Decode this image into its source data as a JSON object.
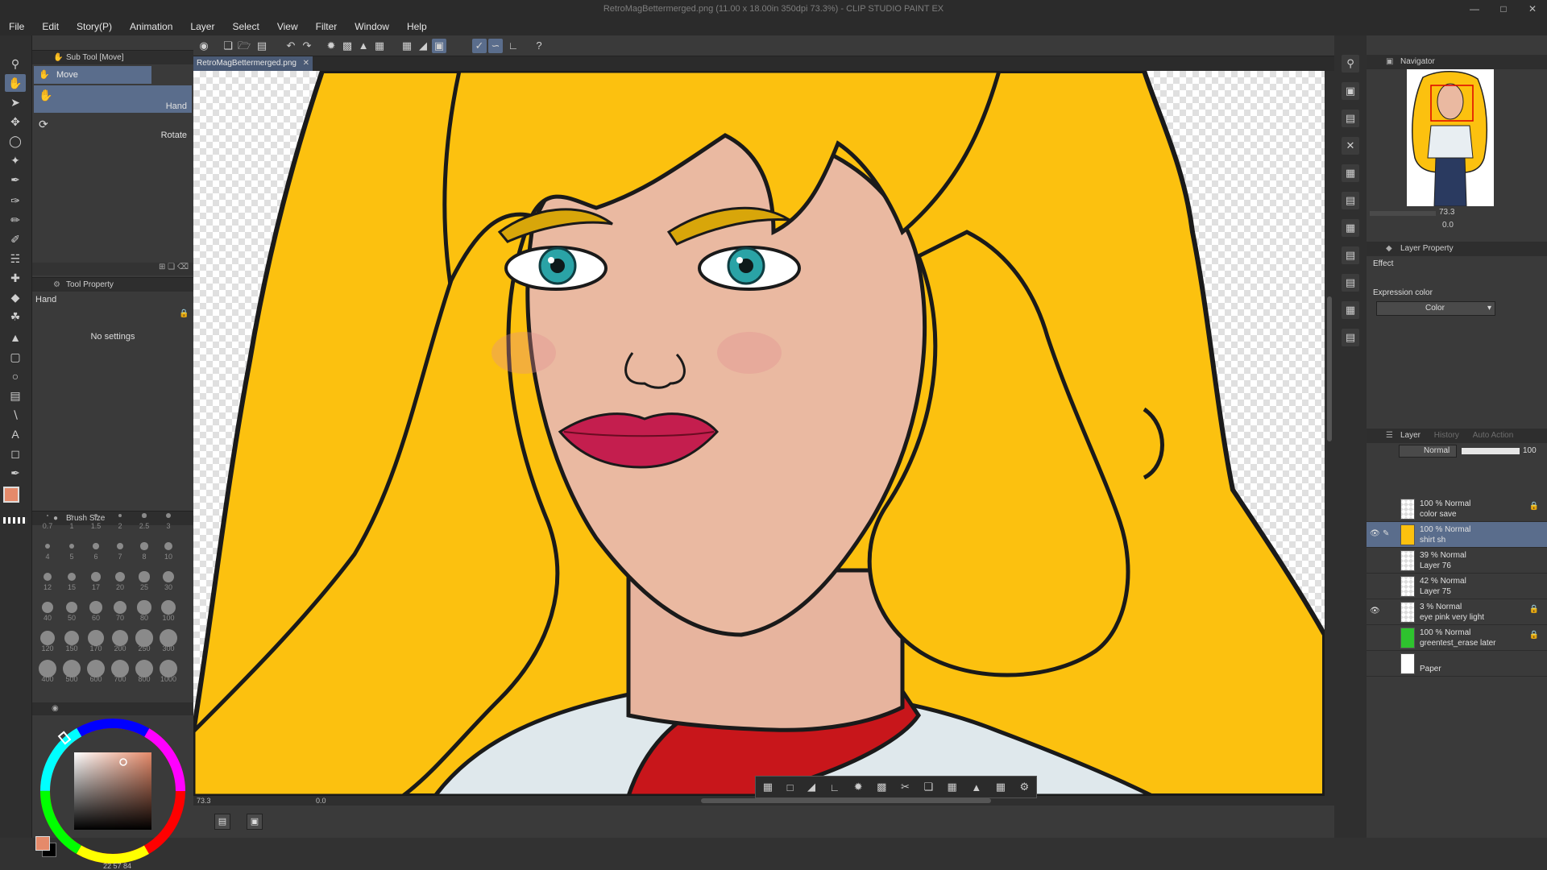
{
  "window": {
    "title": "RetroMagBettermerged.png (11.00 x 18.00in 350dpi 73.3%)  - CLIP STUDIO PAINT EX"
  },
  "menu": [
    "File",
    "Edit",
    "Story(P)",
    "Animation",
    "Layer",
    "Select",
    "View",
    "Filter",
    "Window",
    "Help"
  ],
  "subtool": {
    "header": "Sub Tool [Move]",
    "group": "Move",
    "items": [
      {
        "label": "Hand",
        "selected": true
      },
      {
        "label": "Rotate",
        "selected": false
      }
    ]
  },
  "tool_property": {
    "header": "Tool Property",
    "tool_name": "Hand",
    "message": "No settings"
  },
  "brush_size": {
    "header": "Brush Size",
    "sizes": [
      "0.7",
      "1",
      "1.5",
      "2",
      "2.5",
      "3",
      "4",
      "5",
      "6",
      "7",
      "8",
      "10",
      "12",
      "15",
      "17",
      "20",
      "25",
      "30",
      "40",
      "50",
      "60",
      "70",
      "80",
      "100",
      "120",
      "150",
      "170",
      "200",
      "250",
      "300",
      "400",
      "500",
      "600",
      "700",
      "800",
      "1000"
    ]
  },
  "color": {
    "main": "#e58a6a",
    "sub": "#000000",
    "readout": "22  57  84"
  },
  "canvas": {
    "tab": "RetroMagBettermerged.png",
    "zoom": "73.3",
    "rotation": "0.0"
  },
  "navigator": {
    "header": "Navigator",
    "zoom": "73.3",
    "angle": "0.0"
  },
  "layer_property": {
    "header": "Layer Property",
    "effect_label": "Effect",
    "expression_label": "Expression color",
    "expression_value": "Color"
  },
  "layer_panel": {
    "tabs": [
      "Layer",
      "History",
      "Auto Action"
    ],
    "blend_mode": "Normal",
    "opacity": "100",
    "layers": [
      {
        "line1": "100 % Normal",
        "line2": "color save",
        "visible": false,
        "selected": false,
        "thumb": "checker",
        "locked": true
      },
      {
        "line1": "100 % Normal",
        "line2": "shirt sh",
        "visible": true,
        "selected": true,
        "thumb": "hair",
        "locked": false
      },
      {
        "line1": "39 % Normal",
        "line2": "Layer 76",
        "visible": false,
        "selected": false,
        "thumb": "checker",
        "locked": false
      },
      {
        "line1": "42 % Normal",
        "line2": "Layer 75",
        "visible": false,
        "selected": false,
        "thumb": "checker",
        "locked": false
      },
      {
        "line1": "3 % Normal",
        "line2": "eye pink very light",
        "visible": true,
        "selected": false,
        "thumb": "checker",
        "locked": true
      },
      {
        "line1": "100 % Normal",
        "line2": "greentest_erase later",
        "visible": false,
        "selected": false,
        "thumb": "green",
        "locked": true
      },
      {
        "line1": "",
        "line2": "Paper",
        "visible": false,
        "selected": false,
        "thumb": "white",
        "locked": false
      }
    ]
  }
}
